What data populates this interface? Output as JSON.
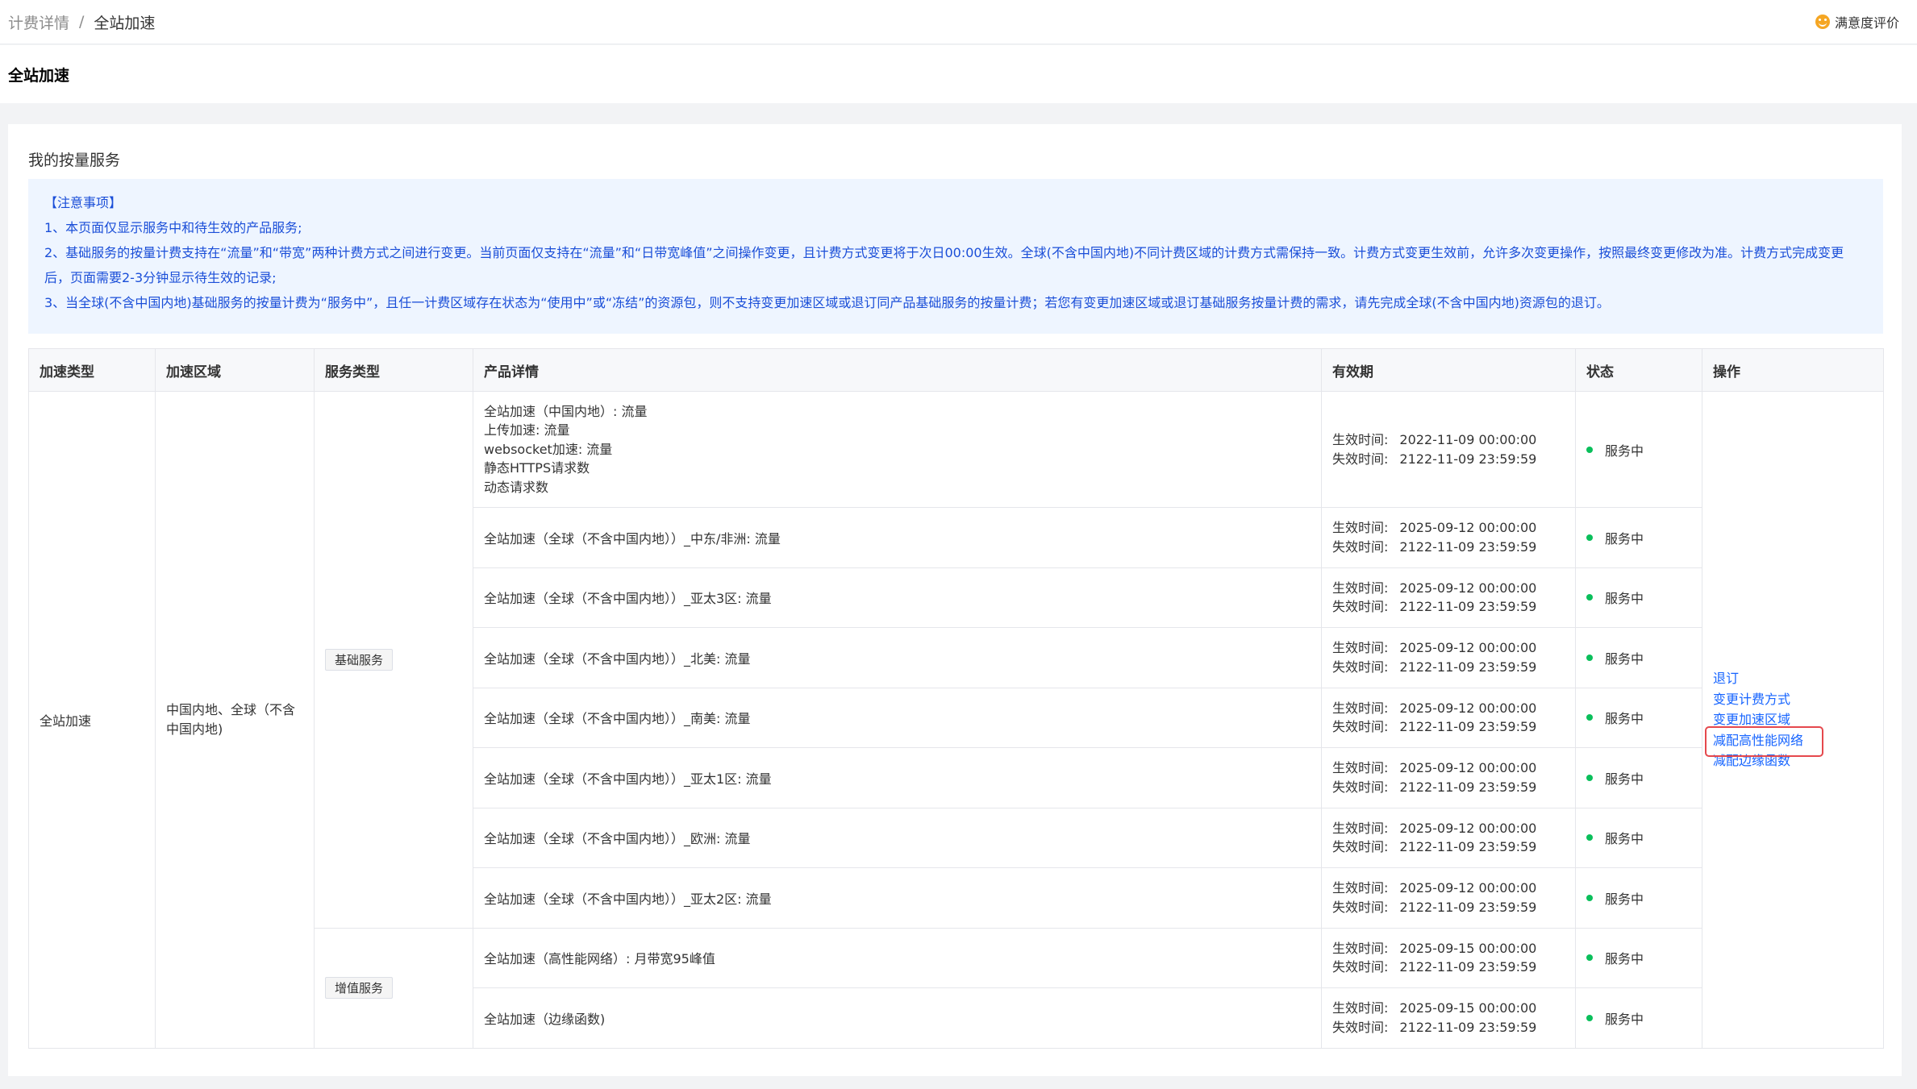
{
  "breadcrumb": {
    "parent": "计费详情",
    "separator": "/",
    "current": "全站加速"
  },
  "feedback": {
    "label": "满意度评价",
    "icon": "smile-icon"
  },
  "page_title": "全站加速",
  "section_title": "我的按量服务",
  "notice": {
    "heading": "【注意事项】",
    "items": [
      "1、本页面仅显示服务中和待生效的产品服务;",
      "2、基础服务的按量计费支持在“流量”和“带宽”两种计费方式之间进行变更。当前页面仅支持在“流量”和“日带宽峰值”之间操作变更，且计费方式变更将于次日00:00生效。全球(不含中国内地)不同计费区域的计费方式需保持一致。计费方式变更生效前，允许多次变更操作，按照最终变更修改为准。计费方式完成变更后，页面需要2-3分钟显示待生效的记录;",
      "3、当全球(不含中国内地)基础服务的按量计费为“服务中”，且任一计费区域存在状态为“使用中”或“冻结”的资源包，则不支持变更加速区域或退订同产品基础服务的按量计费；若您有变更加速区域或退订基础服务按量计费的需求，请先完成全球(不含中国内地)资源包的退订。"
    ]
  },
  "table": {
    "headers": [
      "加速类型",
      "加速区域",
      "服务类型",
      "产品详情",
      "有效期",
      "状态",
      "操作"
    ],
    "accel_type": "全站加速",
    "accel_region": "中国内地、全球（不含中国内地)",
    "service_basic": "基础服务",
    "service_value": "增值服务",
    "start_label": "生效时间:",
    "end_label": "失效时间:",
    "rows": [
      {
        "details": [
          "全站加速（中国内地）: 流量",
          "上传加速: 流量",
          "websocket加速: 流量",
          "静态HTTPS请求数",
          "动态请求数"
        ],
        "start": "2022-11-09 00:00:00",
        "end": "2122-11-09 23:59:59",
        "status": "服务中"
      },
      {
        "detail": "全站加速（全球（不含中国内地））_中东/非洲: 流量",
        "start": "2025-09-12 00:00:00",
        "end": "2122-11-09 23:59:59",
        "status": "服务中"
      },
      {
        "detail": "全站加速（全球（不含中国内地））_亚太3区: 流量",
        "start": "2025-09-12 00:00:00",
        "end": "2122-11-09 23:59:59",
        "status": "服务中"
      },
      {
        "detail": "全站加速（全球（不含中国内地））_北美: 流量",
        "start": "2025-09-12 00:00:00",
        "end": "2122-11-09 23:59:59",
        "status": "服务中"
      },
      {
        "detail": "全站加速（全球（不含中国内地））_南美: 流量",
        "start": "2025-09-12 00:00:00",
        "end": "2122-11-09 23:59:59",
        "status": "服务中"
      },
      {
        "detail": "全站加速（全球（不含中国内地））_亚太1区: 流量",
        "start": "2025-09-12 00:00:00",
        "end": "2122-11-09 23:59:59",
        "status": "服务中"
      },
      {
        "detail": "全站加速（全球（不含中国内地））_欧洲: 流量",
        "start": "2025-09-12 00:00:00",
        "end": "2122-11-09 23:59:59",
        "status": "服务中"
      },
      {
        "detail": "全站加速（全球（不含中国内地））_亚太2区: 流量",
        "start": "2025-09-12 00:00:00",
        "end": "2122-11-09 23:59:59",
        "status": "服务中"
      },
      {
        "detail": "全站加速（高性能网络）: 月带宽95峰值",
        "start": "2025-09-15 00:00:00",
        "end": "2122-11-09 23:59:59",
        "status": "服务中"
      },
      {
        "detail": "全站加速（边缘函数)",
        "start": "2025-09-15 00:00:00",
        "end": "2122-11-09 23:59:59",
        "status": "服务中"
      }
    ],
    "actions": [
      "退订",
      "变更计费方式",
      "变更加速区域",
      "减配高性能网络",
      "减配边缘函数"
    ]
  },
  "colors": {
    "link": "#1664ff",
    "notice_text": "#1a4ed8",
    "notice_bg": "#eef5ff",
    "status_dot": "#0abf5b",
    "highlight_box": "#e5484d"
  }
}
